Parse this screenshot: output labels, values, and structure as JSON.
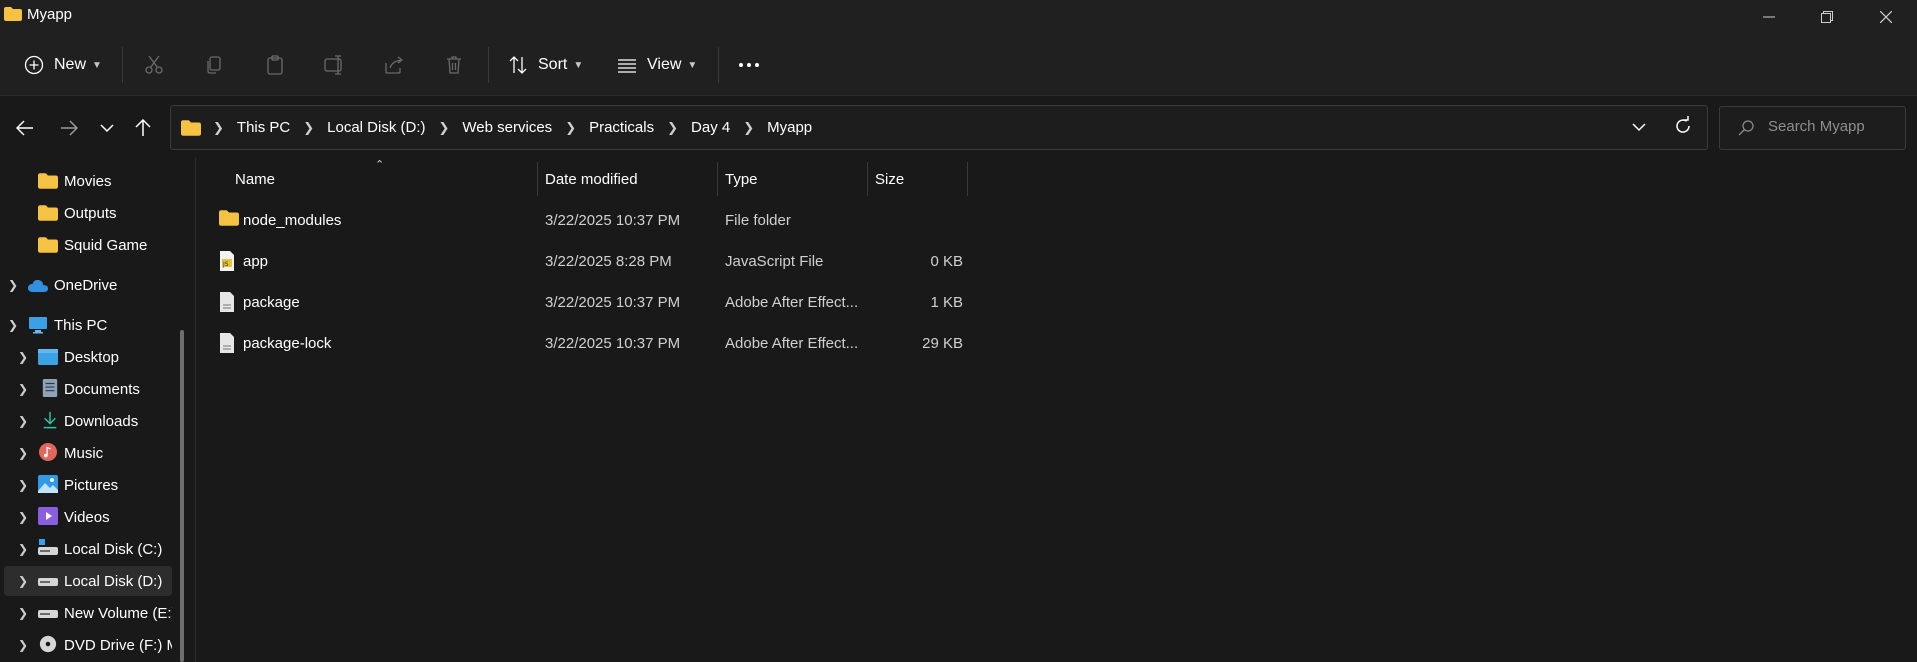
{
  "window": {
    "title": "Myapp"
  },
  "toolbar": {
    "new_label": "New",
    "sort_label": "Sort",
    "view_label": "View"
  },
  "breadcrumbs": [
    "This PC",
    "Local Disk (D:)",
    "Web services",
    "Practicals",
    "Day 4",
    "Myapp"
  ],
  "search": {
    "placeholder": "Search Myapp"
  },
  "sidebar": {
    "items": [
      {
        "label": "Movies",
        "icon": "folder-icon"
      },
      {
        "label": "Outputs",
        "icon": "folder-icon"
      },
      {
        "label": "Squid Game",
        "icon": "folder-icon"
      },
      {
        "label": "OneDrive",
        "icon": "cloud-icon"
      },
      {
        "label": "This PC",
        "icon": "computer-icon"
      },
      {
        "label": "Desktop",
        "icon": "desktop-icon"
      },
      {
        "label": "Documents",
        "icon": "documents-icon"
      },
      {
        "label": "Downloads",
        "icon": "download-icon"
      },
      {
        "label": "Music",
        "icon": "music-icon"
      },
      {
        "label": "Pictures",
        "icon": "pictures-icon"
      },
      {
        "label": "Videos",
        "icon": "videos-icon"
      },
      {
        "label": "Local Disk (C:)",
        "icon": "drive-icon"
      },
      {
        "label": "Local Disk (D:)",
        "icon": "drive-icon"
      },
      {
        "label": "New Volume (E:)",
        "icon": "drive-icon"
      },
      {
        "label": "DVD Drive (F:) M",
        "icon": "dvd-icon"
      }
    ]
  },
  "columns": {
    "name": "Name",
    "date": "Date modified",
    "type": "Type",
    "size": "Size"
  },
  "files": [
    {
      "name": "node_modules",
      "date": "3/22/2025 10:37 PM",
      "type": "File folder",
      "size": "",
      "icon": "folder-icon"
    },
    {
      "name": "app",
      "date": "3/22/2025 8:28 PM",
      "type": "JavaScript File",
      "size": "0 KB",
      "icon": "js-file-icon"
    },
    {
      "name": "package",
      "date": "3/22/2025 10:37 PM",
      "type": "Adobe After Effect...",
      "size": "1 KB",
      "icon": "file-icon"
    },
    {
      "name": "package-lock",
      "date": "3/22/2025 10:37 PM",
      "type": "Adobe After Effect...",
      "size": "29 KB",
      "icon": "file-icon"
    }
  ],
  "colors": {
    "background": "#191919",
    "bar": "#202020",
    "folder": "#f5c242",
    "accent": "#4cc2ff"
  }
}
